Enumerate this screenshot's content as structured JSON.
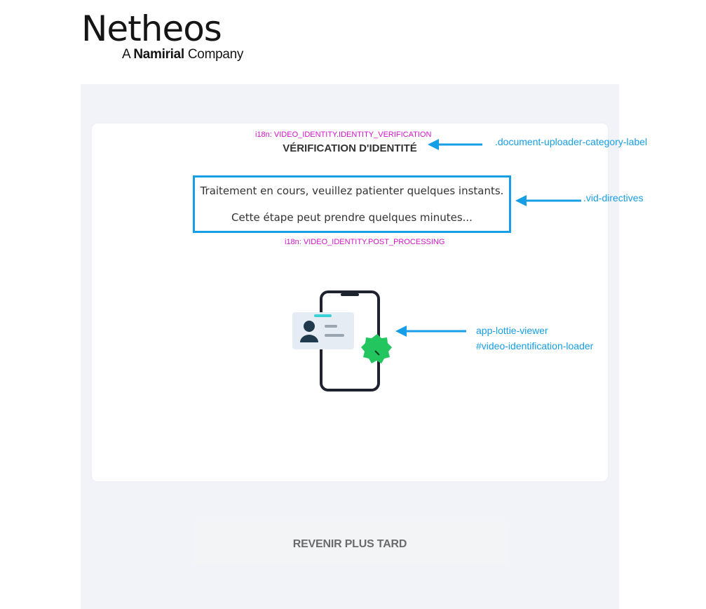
{
  "logo": {
    "brand": "Netheos",
    "sub_prefix": "A",
    "sub_bold": "Namirial",
    "sub_suffix": "Company"
  },
  "card": {
    "i18n_title_key": "i18n: VIDEO_IDENTITY.IDENTITY_VERIFICATION",
    "title": "VÉRIFICATION D'IDENTITÉ",
    "directive_1": "Traitement en cours, veuillez patienter quelques instants.",
    "directive_2": "Cette étape peut prendre quelques minutes...",
    "i18n_directives_key": "i18n: VIDEO_IDENTITY.POST_PROCESSING"
  },
  "annotations": {
    "category_label": ".document-uploader-category-label",
    "vid_directives": ".vid-directives",
    "lottie_viewer": "app-lottie-viewer",
    "loader_id": "#video-identification-loader"
  },
  "actions": {
    "come_back_later": "REVENIR PLUS TARD"
  },
  "colors": {
    "annotation_blue": "#169ee6",
    "i18n_magenta": "#d214c8",
    "panel_bg": "#f1f3f9",
    "badge_green": "#22c55e",
    "accent_cyan": "#2bb3d6"
  },
  "icons": [
    "phone-icon",
    "id-card-icon",
    "verified-badge-icon",
    "arrow-left-icon"
  ]
}
